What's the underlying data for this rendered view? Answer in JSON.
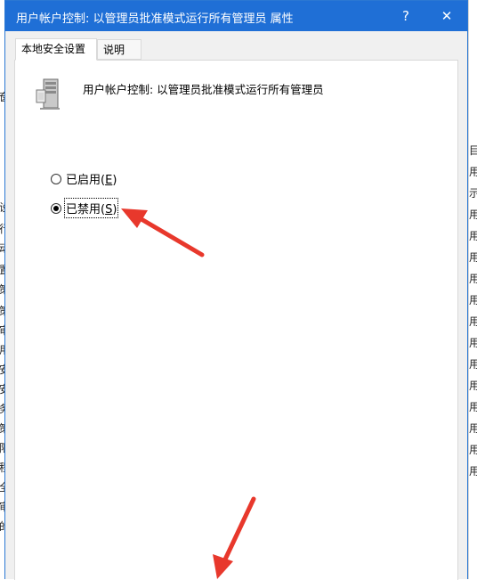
{
  "dialog": {
    "title": "用户帐户控制: 以管理员批准模式运行所有管理员 属性",
    "help_glyph": "?",
    "close_glyph": "✕"
  },
  "tabs": [
    {
      "label": "本地安全设置",
      "active": true
    },
    {
      "label": "说明",
      "active": false
    }
  ],
  "policy": {
    "title": "用户帐户控制: 以管理员批准模式运行所有管理员",
    "icon": "server-icon"
  },
  "options": [
    {
      "label": "已启用",
      "accel": "E",
      "checked": false
    },
    {
      "label": "已禁用",
      "accel": "S",
      "checked": true
    }
  ],
  "background_left": [
    "奁",
    "设",
    "行",
    "动",
    "置",
    "策",
    "策",
    "审",
    "用",
    "安",
    "安",
    "务",
    "策",
    "限",
    "程",
    "全",
    "审",
    "的"
  ],
  "background_right": [
    "目",
    "用",
    "示",
    "用",
    "用",
    "用",
    "用",
    "用",
    "用",
    "用",
    "用",
    "用",
    "用",
    "用",
    "用",
    "用"
  ],
  "colors": {
    "titlebar": "#1f6fd6",
    "annotation_arrow": "#e8382c"
  }
}
